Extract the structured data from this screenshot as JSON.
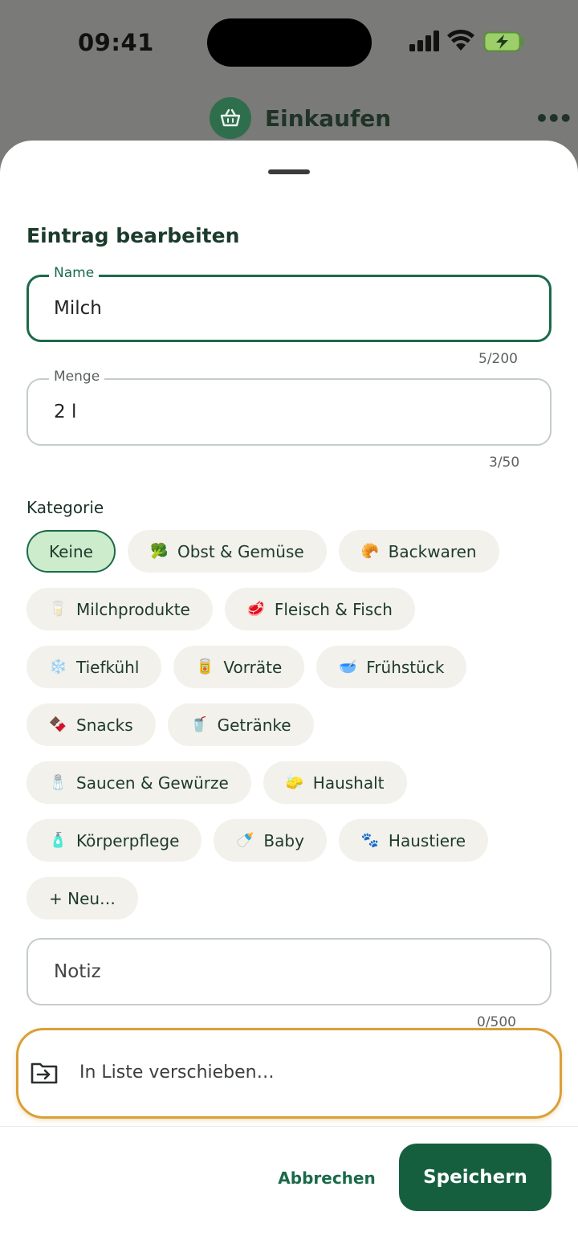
{
  "status_bar": {
    "time": "09:41"
  },
  "app_header": {
    "title": "Einkaufen",
    "more_label": "•••"
  },
  "sheet": {
    "title": "Eintrag bearbeiten",
    "name_field": {
      "label": "Name",
      "value": "Milch",
      "counter": "5/200"
    },
    "amount_field": {
      "label": "Menge",
      "value": "2 l",
      "counter": "3/50"
    },
    "category_label": "Kategorie",
    "categories": [
      {
        "label": "Keine",
        "icon": "",
        "selected": true
      },
      {
        "label": "Obst & Gemüse",
        "icon": "🥦"
      },
      {
        "label": "Backwaren",
        "icon": "🥐"
      },
      {
        "label": "Milchprodukte",
        "icon": "🥛"
      },
      {
        "label": "Fleisch & Fisch",
        "icon": "🥩"
      },
      {
        "label": "Tiefkühl",
        "icon": "❄️"
      },
      {
        "label": "Vorräte",
        "icon": "🥫"
      },
      {
        "label": "Frühstück",
        "icon": "🥣"
      },
      {
        "label": "Snacks",
        "icon": "🍫"
      },
      {
        "label": "Getränke",
        "icon": "🥤"
      },
      {
        "label": "Saucen & Gewürze",
        "icon": "🧂"
      },
      {
        "label": "Haushalt",
        "icon": "🧽"
      },
      {
        "label": "Körperpflege",
        "icon": "🧴"
      },
      {
        "label": "Baby",
        "icon": "🍼"
      },
      {
        "label": "Haustiere",
        "icon": "🐾"
      },
      {
        "label": "+ Neu…",
        "icon": ""
      }
    ],
    "note_field": {
      "placeholder": "Notiz",
      "counter": "0/500"
    },
    "move_label": "In Liste verschieben…",
    "cancel_label": "Abbrechen",
    "save_label": "Speichern"
  },
  "colors": {
    "accent": "#155f3f",
    "selected_chip": "#cdeccc",
    "highlight": "#d9a038"
  }
}
